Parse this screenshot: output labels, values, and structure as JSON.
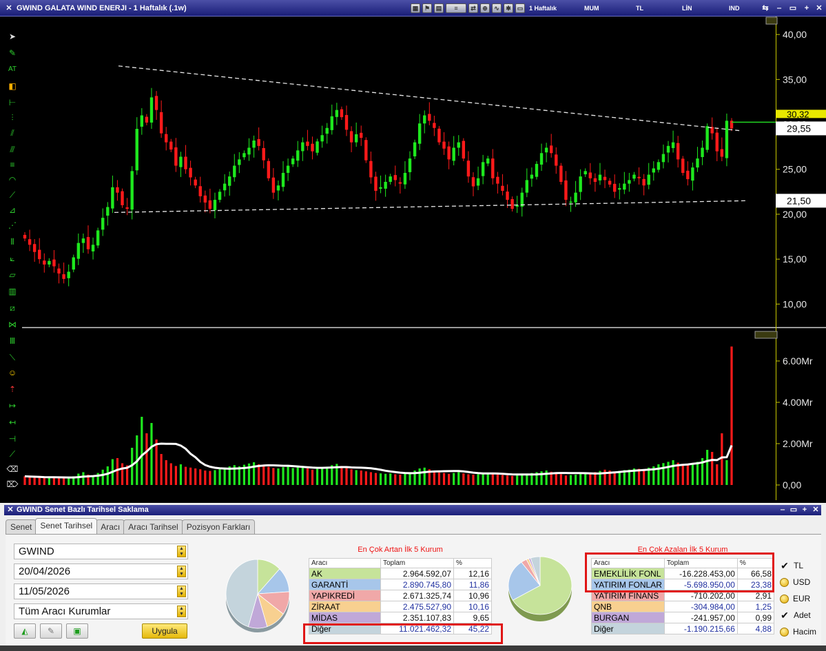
{
  "window": {
    "title": "GWIND GALATA WIND ENERJI - 1 Haftalık (.1w)",
    "toolbar_labels": [
      "1 Haftalık",
      "MUM",
      "TL",
      "LİN",
      "IND"
    ]
  },
  "price_axis": {
    "ticks": [
      "40,00",
      "35,00",
      "30,00",
      "25,00",
      "20,00",
      "15,00",
      "10,00"
    ],
    "current_price": "29,55",
    "marker_price": "21,50",
    "hidden_price": "30,32"
  },
  "volume_axis": {
    "ticks": [
      "6.00Mr",
      "4.00Mr",
      "2.00Mr",
      "0,00"
    ]
  },
  "colors": {
    "up": "#1ee81e",
    "down": "#ff1a1a",
    "axis": "#c8c800",
    "line": "#ffffff",
    "current": "#22d622"
  },
  "chart_data": {
    "type": "candlestick",
    "series_close": [
      17.3,
      16.6,
      15.8,
      15.0,
      14.4,
      14.8,
      14.2,
      13.4,
      12.8,
      13.6,
      15.2,
      16.8,
      17.3,
      16.1,
      16.6,
      18.2,
      19.6,
      20.8,
      23.0,
      22.4,
      21.0,
      20.6,
      24.8,
      29.5,
      31.0,
      30.2,
      33.0,
      31.6,
      29.0,
      28.0,
      27.2,
      25.4,
      26.4,
      25.0,
      24.1,
      23.2,
      22.0,
      21.3,
      20.6,
      21.6,
      22.5,
      23.4,
      24.2,
      25.4,
      26.1,
      26.8,
      27.4,
      28.2,
      27.6,
      26.0,
      24.0,
      22.4,
      23.2,
      24.6,
      25.4,
      26.2,
      27.1,
      28.0,
      27.6,
      27.0,
      28.1,
      28.8,
      29.6,
      30.9,
      31.6,
      30.8,
      29.4,
      28.0,
      28.9,
      28.5,
      26.0,
      24.1,
      22.6,
      23.0,
      23.6,
      24.2,
      23.8,
      23.4,
      24.6,
      26.2,
      28.0,
      30.1,
      31.0,
      30.4,
      29.6,
      28.0,
      27.3,
      26.1,
      27.4,
      28.0,
      26.2,
      24.2,
      23.1,
      24.0,
      25.8,
      26.2,
      24.0,
      23.4,
      22.6,
      21.6,
      20.6,
      21.0,
      22.4,
      23.8,
      24.4,
      25.6,
      26.8,
      27.4,
      26.8,
      25.4,
      23.6,
      21.6,
      21.4,
      22.4,
      24.2,
      24.8,
      24.0,
      23.6,
      24.4,
      23.8,
      23.3,
      22.5,
      22.9,
      23.4,
      23.8,
      24.4,
      24.0,
      23.2,
      24.4,
      25.1,
      25.8,
      26.7,
      27.6,
      28.0,
      26.1,
      24.6,
      23.9,
      25.2,
      26.2,
      27.4,
      29.8,
      29.0,
      27.0,
      26.4,
      30.4,
      29.55
    ],
    "series_volume": [
      0.42,
      0.4,
      0.38,
      0.36,
      0.34,
      0.36,
      0.38,
      0.33,
      0.32,
      0.35,
      0.42,
      0.55,
      0.62,
      0.5,
      0.46,
      0.58,
      0.74,
      0.9,
      1.25,
      1.3,
      1.05,
      0.95,
      1.8,
      2.4,
      3.3,
      2.5,
      3.0,
      2.2,
      1.5,
      1.2,
      1.05,
      0.92,
      1.0,
      0.88,
      0.84,
      0.8,
      0.76,
      0.7,
      0.68,
      0.72,
      0.76,
      0.84,
      0.9,
      0.96,
      0.9,
      0.98,
      1.04,
      1.1,
      1.0,
      0.92,
      0.88,
      0.82,
      0.8,
      0.86,
      0.9,
      0.82,
      0.86,
      0.92,
      0.8,
      0.74,
      0.78,
      0.82,
      0.86,
      0.96,
      1.02,
      0.92,
      0.84,
      0.76,
      0.72,
      0.7,
      0.66,
      0.62,
      0.58,
      0.56,
      0.54,
      0.56,
      0.52,
      0.5,
      0.55,
      0.62,
      0.7,
      0.8,
      0.84,
      0.76,
      0.7,
      0.6,
      0.58,
      0.54,
      0.58,
      0.62,
      0.56,
      0.52,
      0.5,
      0.52,
      0.58,
      0.6,
      0.54,
      0.5,
      0.48,
      0.46,
      0.44,
      0.46,
      0.5,
      0.54,
      0.58,
      0.62,
      0.66,
      0.7,
      0.64,
      0.58,
      0.52,
      0.46,
      0.48,
      0.5,
      0.56,
      0.6,
      0.58,
      0.62,
      0.68,
      0.74,
      0.7,
      0.64,
      0.68,
      0.72,
      0.74,
      0.8,
      0.78,
      0.76,
      0.84,
      0.9,
      1.0,
      1.06,
      1.12,
      1.2,
      1.08,
      0.98,
      1.0,
      1.04,
      1.12,
      1.3,
      1.7,
      1.6,
      1.0,
      2.5,
      1.2,
      6.7,
      5.3,
      0.7
    ],
    "price_range": [
      7.5,
      42.0
    ],
    "volume_range": [
      0,
      7.0
    ],
    "resistance_line": {
      "start_price": 36.5,
      "end_price": 29.3
    },
    "support_line": {
      "start_price": 20.2,
      "end_price": 21.5
    },
    "current_line_price": 29.55
  },
  "panel": {
    "title": "GWIND Senet Bazlı Tarihsel Saklama",
    "tabs": [
      "Senet",
      "Senet Tarihsel",
      "Aracı",
      "Aracı Tarihsel",
      "Pozisyon Farkları"
    ],
    "symbol": "GWIND",
    "date_from": "20/04/2026",
    "date_to": "11/05/2026",
    "broker_filter": "Tüm Aracı Kurumlar",
    "apply_button": "Uygula",
    "top_gainers": {
      "title": "En Çok Artan İlk 5 Kurum",
      "headers": [
        "Aracı",
        "Toplam",
        "%"
      ],
      "rows": [
        {
          "name": "AK",
          "total": "2.964.592,07",
          "pct": "12,16",
          "color": "#c6e39a",
          "value": 12.16
        },
        {
          "name": "GARANTİ",
          "total": "2.890.745,80",
          "pct": "11,86",
          "color": "#a7c6ea",
          "value": 11.86
        },
        {
          "name": "YAPIKREDİ",
          "total": "2.671.325,74",
          "pct": "10,96",
          "color": "#f0a8a8",
          "value": 10.96
        },
        {
          "name": "ZİRAAT",
          "total": "2.475.527,90",
          "pct": "10,16",
          "color": "#f8d090",
          "value": 10.16
        },
        {
          "name": "MİDAS",
          "total": "2.351.107,83",
          "pct": "9,65",
          "color": "#c0a8d8",
          "value": 9.65
        },
        {
          "name": "Diğer",
          "total": "11.021.462,32",
          "pct": "45,22",
          "color": "#c4d4dc",
          "value": 45.22
        }
      ]
    },
    "top_losers": {
      "title": "En Çok Azalan İlk 5 Kurum",
      "headers": [
        "Aracı",
        "Toplam",
        "%"
      ],
      "rows": [
        {
          "name": "EMEKLİLİK FONL",
          "total": "-16.228.453,00",
          "pct": "66,58",
          "color": "#c6e39a",
          "value": 66.58
        },
        {
          "name": "YATIRIM FONLAR",
          "total": "-5.698.950,00",
          "pct": "23,38",
          "color": "#a7c6ea",
          "value": 23.38
        },
        {
          "name": "YATIRIM FİNANS",
          "total": "-710.202,00",
          "pct": "2,91",
          "color": "#f0a8a8",
          "value": 2.91
        },
        {
          "name": "QNB",
          "total": "-304.984,00",
          "pct": "1,25",
          "color": "#f8d090",
          "value": 1.25
        },
        {
          "name": "BURGAN",
          "total": "-241.957,00",
          "pct": "0,99",
          "color": "#c0a8d8",
          "value": 0.99
        },
        {
          "name": "Diğer",
          "total": "-1.190.215,66",
          "pct": "4,88",
          "color": "#c4d4dc",
          "value": 4.88
        }
      ]
    },
    "options": [
      {
        "label": "TL",
        "checked": true
      },
      {
        "label": "USD",
        "checked": false
      },
      {
        "label": "EUR",
        "checked": false
      },
      {
        "label": "Adet",
        "checked": true
      },
      {
        "label": "Hacim",
        "checked": false
      }
    ]
  }
}
